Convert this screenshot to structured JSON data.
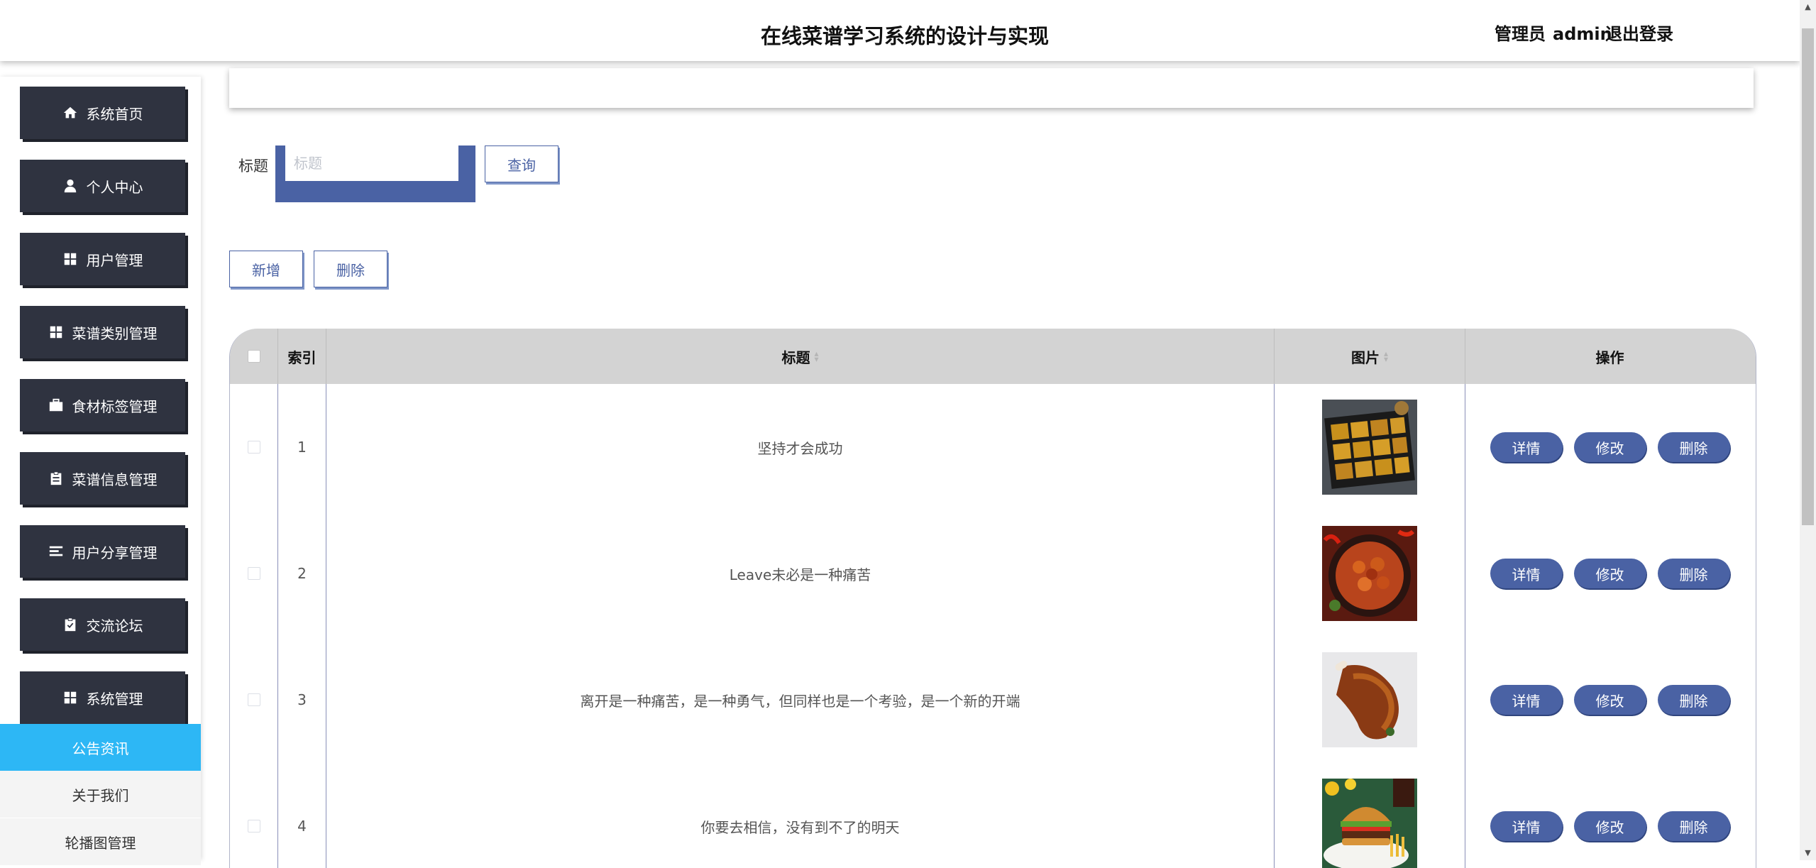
{
  "header": {
    "title": "在线菜谱学习系统的设计与实现",
    "user_role": "管理员",
    "user_name": "admin",
    "logout": "退出登录"
  },
  "sidebar": {
    "items": [
      {
        "label": "系统首页",
        "icon": "home-icon"
      },
      {
        "label": "个人中心",
        "icon": "user-icon"
      },
      {
        "label": "用户管理",
        "icon": "grid-icon"
      },
      {
        "label": "菜谱类别管理",
        "icon": "grid-icon"
      },
      {
        "label": "食材标签管理",
        "icon": "briefcase-icon"
      },
      {
        "label": "菜谱信息管理",
        "icon": "clipboard-icon"
      },
      {
        "label": "用户分享管理",
        "icon": "list-icon"
      },
      {
        "label": "交流论坛",
        "icon": "clipboard-check-icon"
      },
      {
        "label": "系统管理",
        "icon": "grid-icon"
      }
    ],
    "sub_items": [
      {
        "label": "公告资讯",
        "active": true
      },
      {
        "label": "关于我们",
        "active": false
      },
      {
        "label": "轮播图管理",
        "active": false
      }
    ],
    "active_color": "#2db7f5"
  },
  "search": {
    "label": "标题",
    "placeholder": "标题",
    "value": "",
    "button": "查询"
  },
  "actions": {
    "add": "新增",
    "delete": "删除"
  },
  "table": {
    "headers": {
      "index": "索引",
      "title": "标题",
      "image": "图片",
      "operation": "操作"
    },
    "rows": [
      {
        "index": "1",
        "title": "坚持才会成功",
        "image": "baked-pastries-tray"
      },
      {
        "index": "2",
        "title": "Leave未必是一种痛苦",
        "image": "spicy-chicken-dish"
      },
      {
        "index": "3",
        "title": "离开是一种痛苦，是一种勇气，但同样也是一个考验，是一个新的开端",
        "image": "roast-chicken-leg"
      },
      {
        "index": "4",
        "title": "你要去相信，没有到不了的明天",
        "image": "burger-and-fries"
      }
    ],
    "row_actions": {
      "detail": "详情",
      "edit": "修改",
      "delete": "删除"
    }
  },
  "colors": {
    "primary": "#4a62a4",
    "sidebar_bg": "#2f3340",
    "table_header_bg": "#d3d3d3"
  }
}
